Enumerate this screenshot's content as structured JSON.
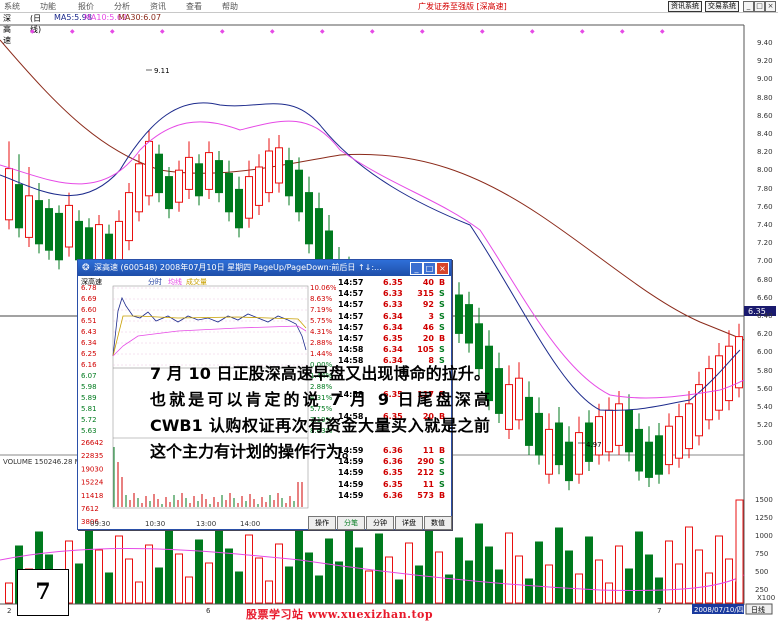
{
  "menu": {
    "items": [
      "系统",
      "功能",
      "报价",
      "分析",
      "资讯",
      "查看",
      "帮助"
    ],
    "title": "广发证券至强版 [深高速]",
    "right_buttons": [
      "资讯系统",
      "交易系统"
    ],
    "window_controls": [
      "_",
      "□",
      "×"
    ]
  },
  "infobar": {
    "stock": "深高速",
    "period": "(日线)",
    "ma5": "MA5:5.98",
    "ma10": "MA10:5.62",
    "ma30": "MA30:6.07"
  },
  "price_axis": [
    "9.40",
    "9.20",
    "9.00",
    "8.80",
    "8.60",
    "8.40",
    "8.20",
    "8.00",
    "7.80",
    "7.60",
    "7.40",
    "7.20",
    "7.00",
    "6.80",
    "6.60",
    "6.40",
    "6.20",
    "6.00",
    "5.80",
    "5.60",
    "5.40",
    "5.20",
    "5.00"
  ],
  "current_price": "6.35",
  "annotations": {
    "high": "9.11",
    "low": "4.97"
  },
  "volume_label": "VOLUME 150246.28 M",
  "volume_axis": [
    "1500",
    "1250",
    "1000",
    "750",
    "500",
    "250"
  ],
  "volume_unit": "X100",
  "date_tag": "2008/07/10/四",
  "period_tab": "日线",
  "x_labels": [
    "2",
    "6",
    "7"
  ],
  "dialog": {
    "title": "深高速 (600548) 2008年07月10日 星期四 PageUp/PageDown:前后日 ↑↓:...",
    "stock_name": "深高速",
    "tab_labels": [
      "分时",
      "均线",
      "成交量"
    ],
    "left_axis": [
      "6.78",
      "6.69",
      "6.60",
      "6.51",
      "6.43",
      "6.34",
      "6.25",
      "6.16",
      "6.07",
      "5.98",
      "5.89",
      "5.81",
      "5.72",
      "5.63"
    ],
    "right_axis": [
      "10.06%",
      "8.63%",
      "7.19%",
      "5.75%",
      "4.31%",
      "2.88%",
      "1.44%",
      "0.00%",
      "1.44%",
      "2.88%",
      "4.31%",
      "5.75%",
      "7.19%",
      "8.63%"
    ],
    "vol_axis": [
      "26642",
      "22835",
      "19030",
      "15224",
      "11418",
      "7612",
      "3806"
    ],
    "vol_right_bottom": "3806",
    "time_axis": [
      "09:30",
      "10:30",
      "13:00",
      "14:00"
    ],
    "ticks": [
      {
        "t": "14:57",
        "p": "6.35",
        "v": "40",
        "s": "B"
      },
      {
        "t": "14:57",
        "p": "6.33",
        "v": "315",
        "s": "S"
      },
      {
        "t": "14:57",
        "p": "6.33",
        "v": "92",
        "s": "S"
      },
      {
        "t": "14:57",
        "p": "6.34",
        "v": "3",
        "s": "S"
      },
      {
        "t": "14:57",
        "p": "6.34",
        "v": "46",
        "s": "S"
      },
      {
        "t": "14:57",
        "p": "6.35",
        "v": "20",
        "s": "B"
      },
      {
        "t": "14:58",
        "p": "6.34",
        "v": "105",
        "s": "S"
      },
      {
        "t": "14:58",
        "p": "6.34",
        "v": "8",
        "s": "S"
      },
      {
        "t": "",
        "p": "",
        "v": "",
        "s": ""
      },
      {
        "t": "",
        "p": "",
        "v": "",
        "s": ""
      },
      {
        "t": "14:58",
        "p": "6.35",
        "v": "117",
        "s": "B"
      },
      {
        "t": "",
        "p": "",
        "v": "",
        "s": ""
      },
      {
        "t": "14:58",
        "p": "6.35",
        "v": "20",
        "s": "B"
      },
      {
        "t": "",
        "p": "",
        "v": "",
        "s": ""
      },
      {
        "t": "",
        "p": "",
        "v": "",
        "s": ""
      },
      {
        "t": "14:59",
        "p": "6.36",
        "v": "11",
        "s": "B"
      },
      {
        "t": "14:59",
        "p": "6.36",
        "v": "290",
        "s": "S"
      },
      {
        "t": "14:59",
        "p": "6.35",
        "v": "212",
        "s": "S"
      },
      {
        "t": "14:59",
        "p": "6.35",
        "v": "11",
        "s": "S"
      },
      {
        "t": "14:59",
        "p": "6.36",
        "v": "573",
        "s": "B"
      }
    ],
    "bottom_tabs": [
      "操作",
      "分笔",
      "分钟",
      "详盘",
      "数值"
    ]
  },
  "overlay_text": "7 月 10 日正股深高速早盘又出现博命的拉升。也就是可以肯定的说 7 月 9 日尾盘深高 CWB1 认购权证再次有资金大量买入就是之前这个主力有计划的操作行为。",
  "number_tag": "7",
  "watermark": "股票学习站  www.xuexizhan.top",
  "colors": {
    "up": "#e81010",
    "down": "#007a1e",
    "ma5": "#1c2a8c",
    "ma10": "#e64ae6",
    "ma30": "#8b2a1a"
  }
}
